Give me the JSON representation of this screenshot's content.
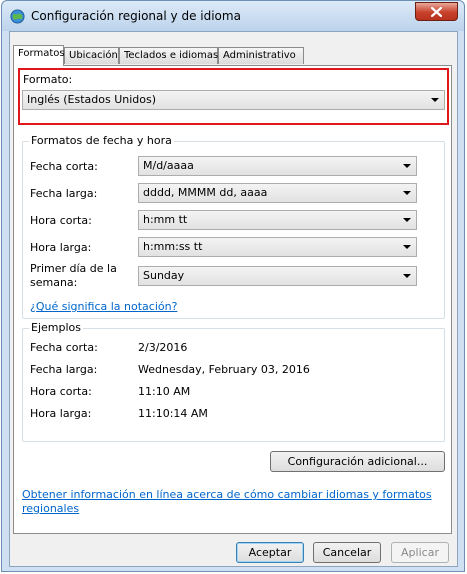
{
  "window": {
    "title": "Configuración regional y de idioma",
    "close_label": "✕"
  },
  "tabs": [
    "Formatos",
    "Ubicación",
    "Teclados e idiomas",
    "Administrativo"
  ],
  "format": {
    "label": "Formato:",
    "value": "Inglés (Estados Unidos)"
  },
  "date_time": {
    "group_title": "Formatos de fecha y hora",
    "short_date": {
      "label": "Fecha corta:",
      "value": "M/d/aaaa"
    },
    "long_date": {
      "label": "Fecha larga:",
      "value": "dddd, MMMM dd, aaaa"
    },
    "short_time": {
      "label": "Hora corta:",
      "value": "h:mm tt"
    },
    "long_time": {
      "label": "Hora larga:",
      "value": "h:mm:ss tt"
    },
    "first_day": {
      "label_line1": "Primer día de la",
      "label_line2": "semana:",
      "value": "Sunday"
    }
  },
  "notation_link": "¿Qué significa la notación?",
  "examples": {
    "group_title": "Ejemplos",
    "short_date": {
      "label": "Fecha corta:",
      "value": "2/3/2016"
    },
    "long_date": {
      "label": "Fecha larga:",
      "value": "Wednesday, February 03, 2016"
    },
    "short_time": {
      "label": "Hora corta:",
      "value": "11:10 AM"
    },
    "long_time": {
      "label": "Hora larga:",
      "value": "11:10:14 AM"
    }
  },
  "additional_settings_button": "Configuración adicional...",
  "online_link": {
    "line1": "Obtener información en línea acerca de cómo cambiar idiomas y formatos",
    "line2": "regionales"
  },
  "buttons": {
    "ok": "Aceptar",
    "cancel": "Cancelar",
    "apply": "Aplicar"
  },
  "colors": {
    "highlight_border": "#e0161b",
    "link": "#0066cc"
  }
}
